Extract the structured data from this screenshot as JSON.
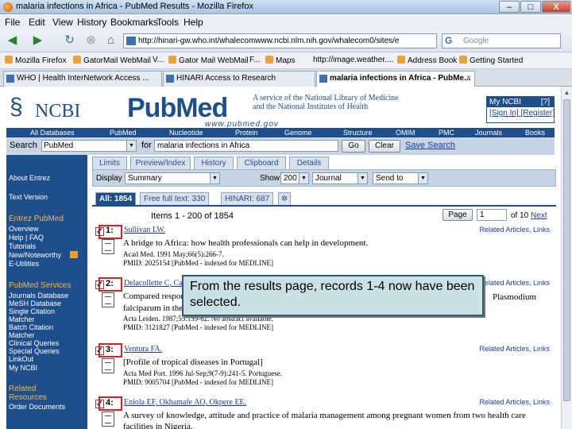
{
  "window": {
    "title": "malaria infections in Africa - PubMed Results - Mozilla Firefox",
    "min": "–",
    "max": "□",
    "close": "X"
  },
  "menu": [
    "File",
    "Edit",
    "View",
    "History",
    "Bookmarks",
    "Tools",
    "Help"
  ],
  "nav": {
    "url": "http://hinari-gw.who.int/whalecomwww.ncbi.nlm.nih.gov/whalecom0/sites/e",
    "search_placeholder": "Google"
  },
  "bookmarks": [
    "Mozilla Firefox",
    "GatorMail WebMail",
    "V...",
    "Gator Mail WebMail",
    "F...",
    "Maps",
    "http://image.weather....",
    "Address Book",
    "Getting Started"
  ],
  "tabs": [
    {
      "label": "WHO | Health InterNetwork Access ...",
      "active": false
    },
    {
      "label": "HINARI Access to Research",
      "active": false
    },
    {
      "label": "malaria infections in Africa - PubMe...",
      "active": true
    }
  ],
  "header": {
    "ncbi": "NCBI",
    "pubmed": "PubMed",
    "pubmed_url": "www.pubmed.gov",
    "service_line1": "A service of the National Library of Medicine",
    "service_line2": "and the National Institutes of Health",
    "my_ncbi": "My NCBI",
    "my_ncbi_help": "[?]",
    "sign_in": "[Sign In]",
    "register": "[Register]"
  },
  "db_nav": [
    "All Databases",
    "PubMed",
    "Nucleotide",
    "Protein",
    "Genome",
    "Structure",
    "OMIM",
    "PMC",
    "Journals",
    "Books"
  ],
  "search": {
    "label": "Search",
    "db": "PubMed",
    "for": "for",
    "term": "malaria infections in Africa",
    "go": "Go",
    "clear": "Clear",
    "save": "Save Search"
  },
  "sidebar": {
    "about": "About Entrez",
    "text_version": "Text Version",
    "entrez_head": "Entrez PubMed",
    "entrez_items": [
      "Overview",
      "Help | FAQ",
      "Tutorials",
      "New/Noteworthy",
      "E-Utilities"
    ],
    "services_head": "PubMed Services",
    "services_items": [
      "Journals Database",
      "MeSH Database",
      "Single Citation",
      "Matcher",
      "Batch Citation",
      "Matcher",
      "Clinical Queries",
      "Special Queries",
      "LinkOut",
      "My NCBI"
    ],
    "related_head1": "Related",
    "related_head2": "Resources",
    "related_items": [
      "Order Documents"
    ]
  },
  "content_tabs": [
    "Limits",
    "Preview/Index",
    "History",
    "Clipboard",
    "Details"
  ],
  "display": {
    "label": "Display",
    "format": "Summary",
    "show_label": "Show",
    "show_value": "200",
    "sort": "Journal",
    "send": "Send to"
  },
  "result_tabs": [
    "All: 1854",
    "Free full text: 330",
    "HINARI: 687"
  ],
  "paging": {
    "items": "Items 1 - 200 of 1854",
    "page_btn": "Page",
    "page_value": "1",
    "of": "of 10",
    "next": "Next"
  },
  "records": [
    {
      "num": "1:",
      "author": "Sullivan LW.",
      "title": "A bridge to Africa: how health professionals can help in development.",
      "line1": "Acad Med. 1991 May;66(5):266-7.",
      "line2": "PMID: 2025154 [PubMed - indexed for MEDLINE]"
    },
    {
      "num": "2:",
      "author": "Delacollette C, Carnevale P.",
      "title": "Compared response of Plasmodium",
      "title_end": "Plasmodium",
      "line1": "falciparum in the",
      "line2": "Acta Leiden. 1987;55:159-62. No abstract available.",
      "line3": "PMID: 3121827 [PubMed - indexed for MEDLINE]"
    },
    {
      "num": "3:",
      "author": "Ventura FA.",
      "title": "[Profile of tropical diseases in Portugal]",
      "line1": "Acta Med Port. 1996 Jul-Sep;9(7-9):241-5. Portuguese.",
      "line2": "PMID: 9005704 [PubMed - indexed for MEDLINE]"
    },
    {
      "num": "4:",
      "author": "Eniola EF, Okhamafe AO, Okpere EE.",
      "title": "A survey of knowledge, attitude and practice of malaria management among pregnant women from two health care",
      "line1": "facilities in Nigeria."
    }
  ],
  "related_label": "Related Articles, Links",
  "callout": "From the results page, records 1-4 now have been selected."
}
